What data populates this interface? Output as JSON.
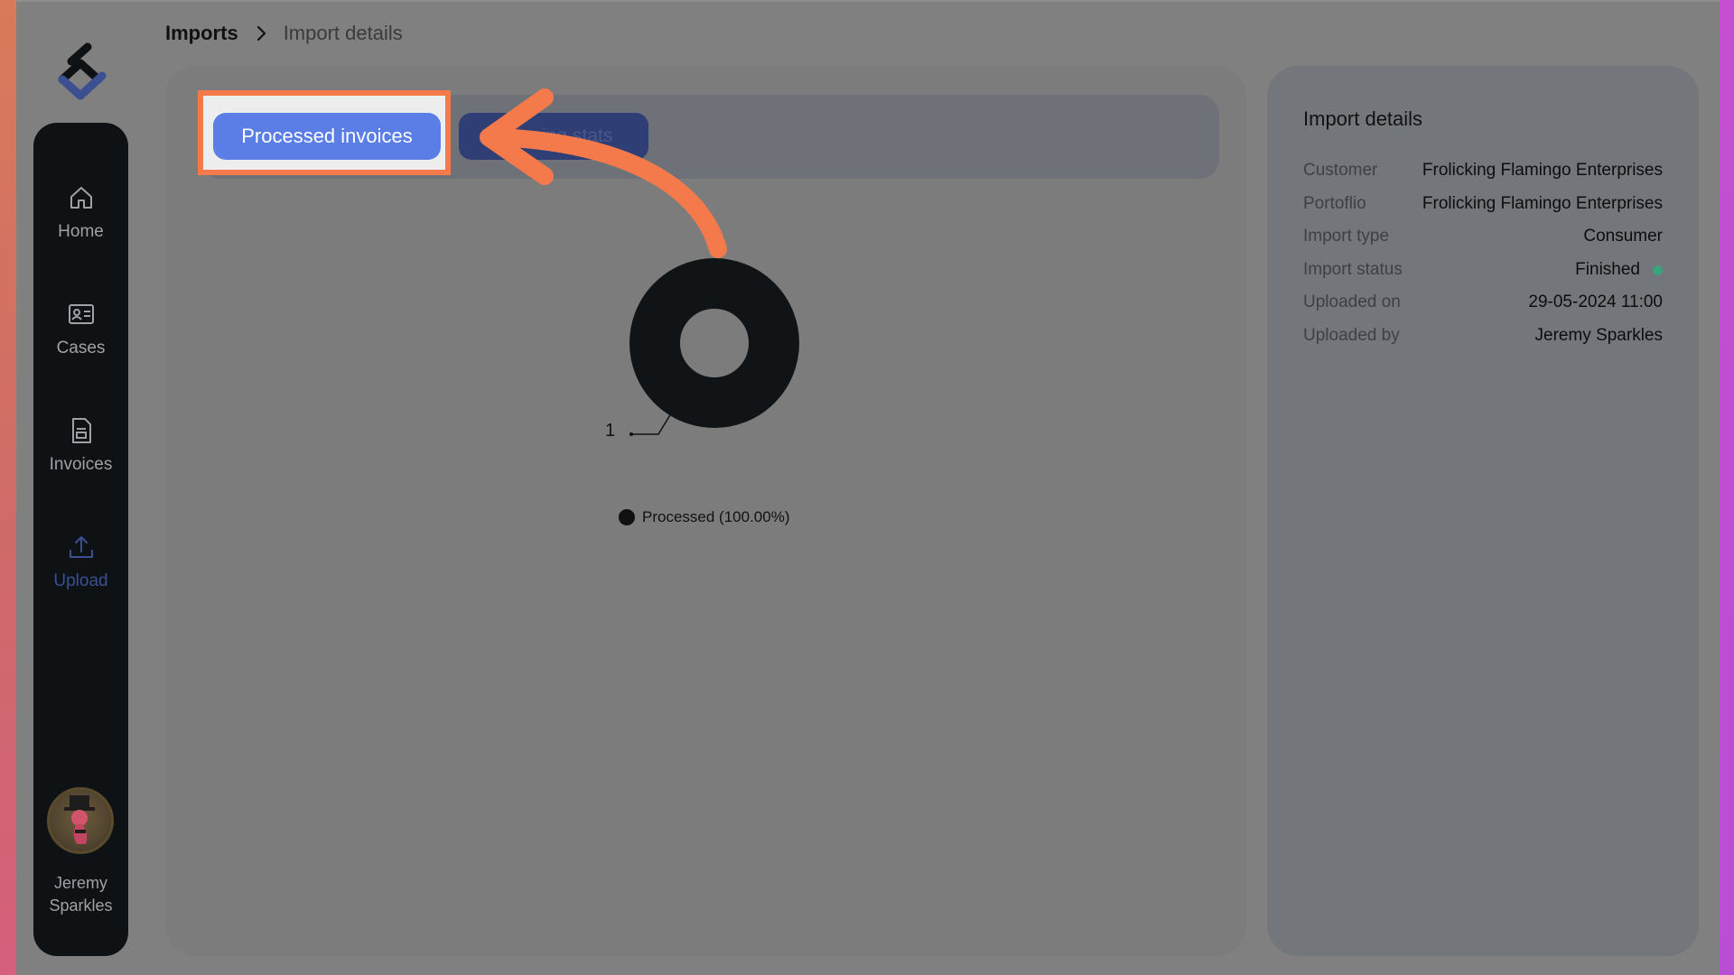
{
  "breadcrumb": {
    "root": "Imports",
    "current": "Import details"
  },
  "sidebar": {
    "items": [
      {
        "label": "Home",
        "icon": "home-icon"
      },
      {
        "label": "Cases",
        "icon": "contact-card-icon"
      },
      {
        "label": "Invoices",
        "icon": "document-icon"
      },
      {
        "label": "Upload",
        "icon": "upload-icon",
        "active": true
      }
    ],
    "user": {
      "first_name": "Jeremy",
      "last_name": "Sparkles"
    }
  },
  "tabs": {
    "primary": "Processed invoices",
    "secondary": "Mapping stats"
  },
  "chart": {
    "slice_label": "1",
    "legend": "Processed (100.00%)"
  },
  "details": {
    "title": "Import details",
    "rows": [
      {
        "key": "Customer",
        "value": "Frolicking Flamingo Enterprises"
      },
      {
        "key": "Portoflio",
        "value": "Frolicking Flamingo Enterprises"
      },
      {
        "key": "Import type",
        "value": "Consumer"
      },
      {
        "key": "Import status",
        "value": "Finished"
      },
      {
        "key": "Uploaded on",
        "value": "29-05-2024 11:00"
      },
      {
        "key": "Uploaded by",
        "value": "Jeremy Sparkles"
      }
    ]
  },
  "colors": {
    "accent": "#5b7ee6",
    "highlight": "#f47a4b",
    "status_finished": "#3aa37a"
  }
}
